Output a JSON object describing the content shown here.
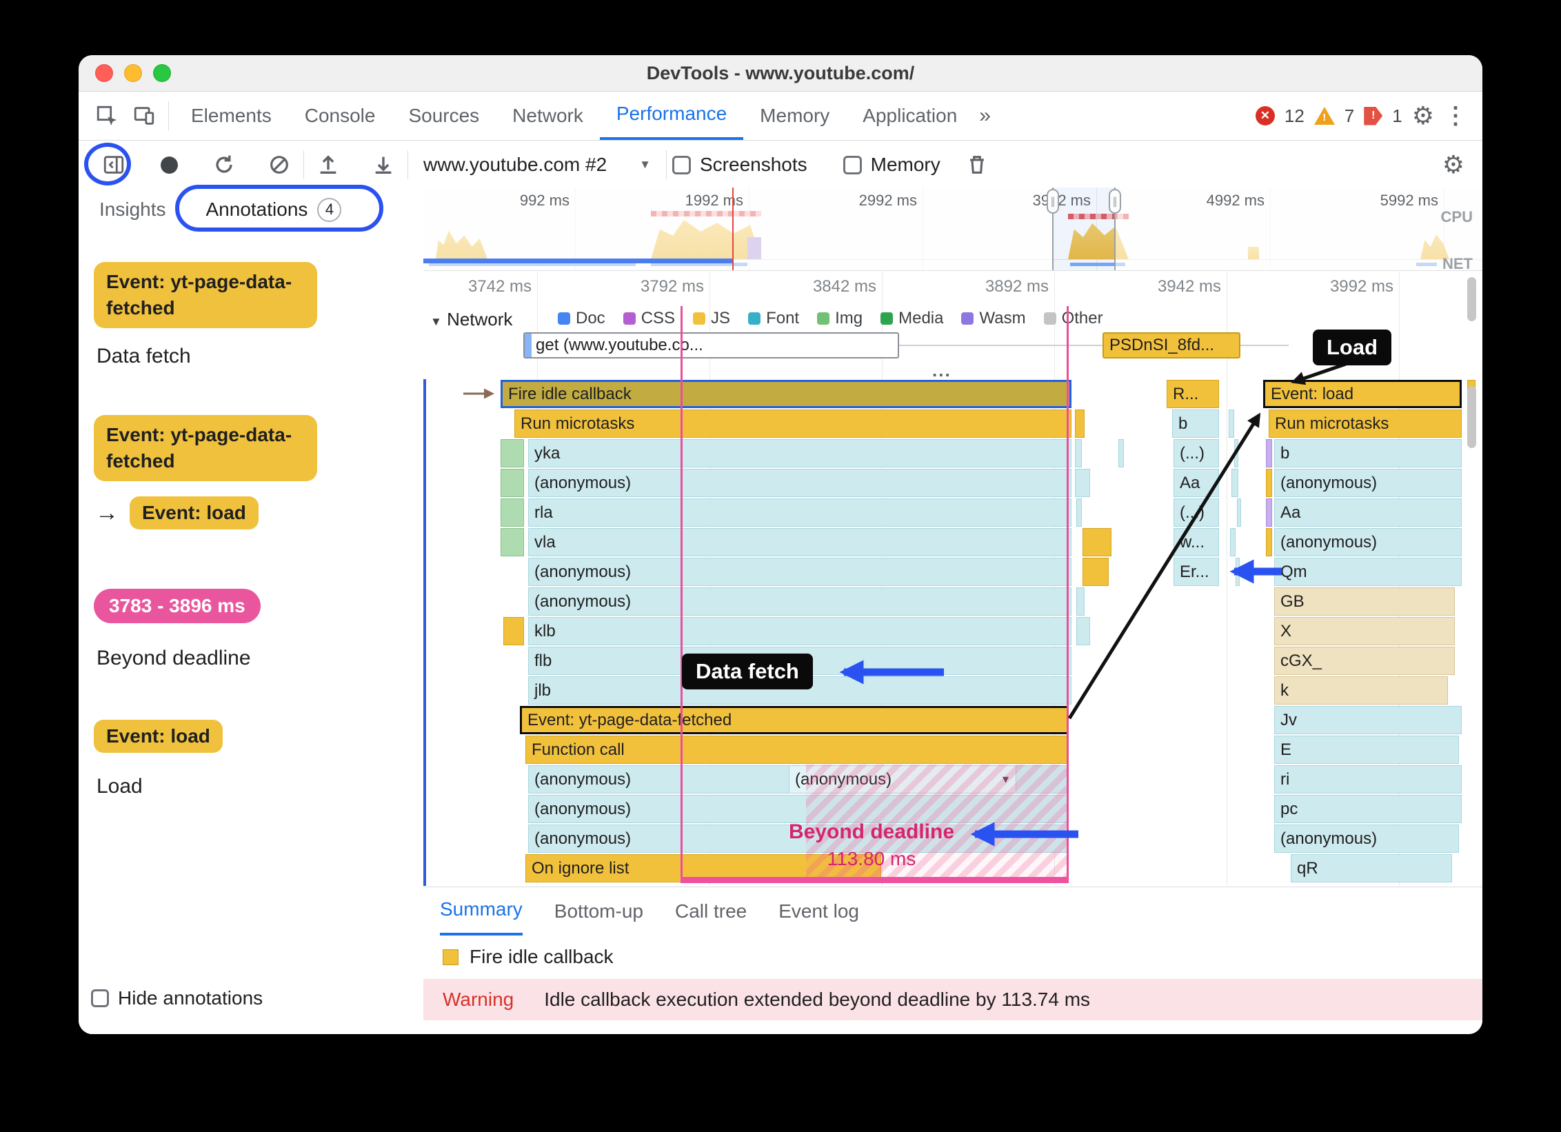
{
  "window": {
    "title": "DevTools - www.youtube.com/"
  },
  "tabbar": {
    "tabs": [
      "Elements",
      "Console",
      "Sources",
      "Network",
      "Performance",
      "Memory",
      "Application"
    ],
    "more_tabs": "»",
    "error_count": "12",
    "warning_count": "7",
    "issue_count": "1"
  },
  "toolbar": {
    "history_select": "www.youtube.com #2",
    "screenshots": "Screenshots",
    "memory": "Memory"
  },
  "sidebar": {
    "insights_tab": "Insights",
    "annotations_tab": "Annotations",
    "annotations_count": "4",
    "annotations": {
      "a1_pill": "Event: yt-page-data-fetched",
      "a1_label": "Data fetch",
      "a2_pill": "Event: yt-page-data-fetched",
      "a2_arrow": "→",
      "a2_pill2": "Event: load",
      "a3_pill": "3783 - 3896 ms",
      "a3_label": "Beyond deadline",
      "a4_pill": "Event: load",
      "a4_label": "Load"
    },
    "hide_annotations": "Hide annotations"
  },
  "overview": {
    "time_labels": [
      "992 ms",
      "1992 ms",
      "2992 ms",
      "3992 ms",
      "4992 ms",
      "5992 ms"
    ],
    "cpu": "CPU",
    "net": "NET"
  },
  "ruler": {
    "labels": [
      "3742 ms",
      "3792 ms",
      "3842 ms",
      "3892 ms",
      "3942 ms",
      "3992 ms"
    ]
  },
  "network": {
    "track": "Network",
    "legend": [
      {
        "label": "Doc",
        "color": "#4484f3"
      },
      {
        "label": "CSS",
        "color": "#b35fd1"
      },
      {
        "label": "JS",
        "color": "#f2c13c"
      },
      {
        "label": "Font",
        "color": "#36b0c8"
      },
      {
        "label": "Img",
        "color": "#71c174"
      },
      {
        "label": "Media",
        "color": "#2da44e"
      },
      {
        "label": "Wasm",
        "color": "#8f76e0"
      },
      {
        "label": "Other",
        "color": "#c4c4c4"
      }
    ],
    "request1": "get (www.youtube.co...",
    "request2": "PSDnSI_8fd..."
  },
  "flame": {
    "left": [
      "Fire idle callback",
      "Run microtasks",
      "yka",
      "(anonymous)",
      "rla",
      "vla",
      "(anonymous)",
      "(anonymous)",
      "klb",
      "flb",
      "jlb",
      "Event: yt-page-data-fetched",
      "Function call",
      "(anonymous)",
      "(anonymous)",
      "(anonymous)",
      "On ignore list"
    ],
    "collapsed": "(anonymous)",
    "mid": [
      "R...",
      "b",
      "(...)",
      "Aa",
      "(...)",
      "w...",
      "Er..."
    ],
    "right": [
      "Event: load",
      "Run microtasks",
      "b",
      "(anonymous)",
      "Aa",
      "(anonymous)",
      "Qm",
      "GB",
      "X",
      "cGX_",
      "k",
      "Jv",
      "E",
      "ri",
      "pc",
      "(anonymous)",
      "qR"
    ]
  },
  "overlays": {
    "load": "Load",
    "data_fetch": "Data fetch",
    "beyond_deadline": "Beyond deadline",
    "beyond_ms": "113.80 ms",
    "dots": "..."
  },
  "bottom": {
    "tabs": [
      "Summary",
      "Bottom-up",
      "Call tree",
      "Event log"
    ],
    "selected_event": "Fire idle callback",
    "warning_label": "Warning",
    "warning_text": "Idle callback execution extended beyond deadline by 113.74 ms"
  },
  "colors": {
    "accent_blue": "#1a73e8",
    "annotation_blue": "#2a52f0",
    "event_yellow": "#f2c13c",
    "script_teal": "#cdeaef",
    "annotation_pink": "#e9569e",
    "deadline_pink": "#d6246e",
    "warning_red": "#d93025"
  }
}
